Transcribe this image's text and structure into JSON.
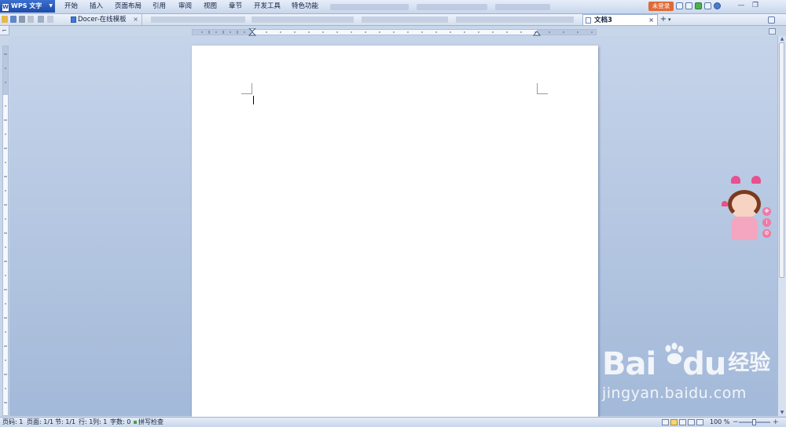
{
  "app": {
    "name": "WPS 文字",
    "logo": "W"
  },
  "menu": {
    "items": [
      "开始",
      "插入",
      "页面布局",
      "引用",
      "审阅",
      "视图",
      "章节",
      "开发工具",
      "特色功能"
    ],
    "login_label": "未登录"
  },
  "window_controls": {
    "minimize": "—",
    "restore": "❐"
  },
  "tabs": {
    "docer_label": "Docer-在线模板",
    "active_label": "文档3",
    "close_glyph": "×",
    "new_tab_glyph": "+",
    "tab_menu_glyph": "▾"
  },
  "status": {
    "page_code": "页码: 1",
    "page": "页面: 1/1",
    "section": "节: 1/1",
    "line": "行: 1",
    "column": "列: 1",
    "word_count": "字数: 0",
    "spell_check": "拼写检查",
    "zoom": "100 %",
    "zoom_minus": "−",
    "zoom_plus": "+"
  },
  "watermark": {
    "brand_prefix": "Bai",
    "brand_suffix": "du",
    "brand_cn": "经验",
    "url": "jingyan.baidu.com"
  },
  "colors": {
    "app_button": "#1d4aa6",
    "login_button": "#e06a36",
    "workspace": "#b3c6e2",
    "page": "#ffffff"
  }
}
